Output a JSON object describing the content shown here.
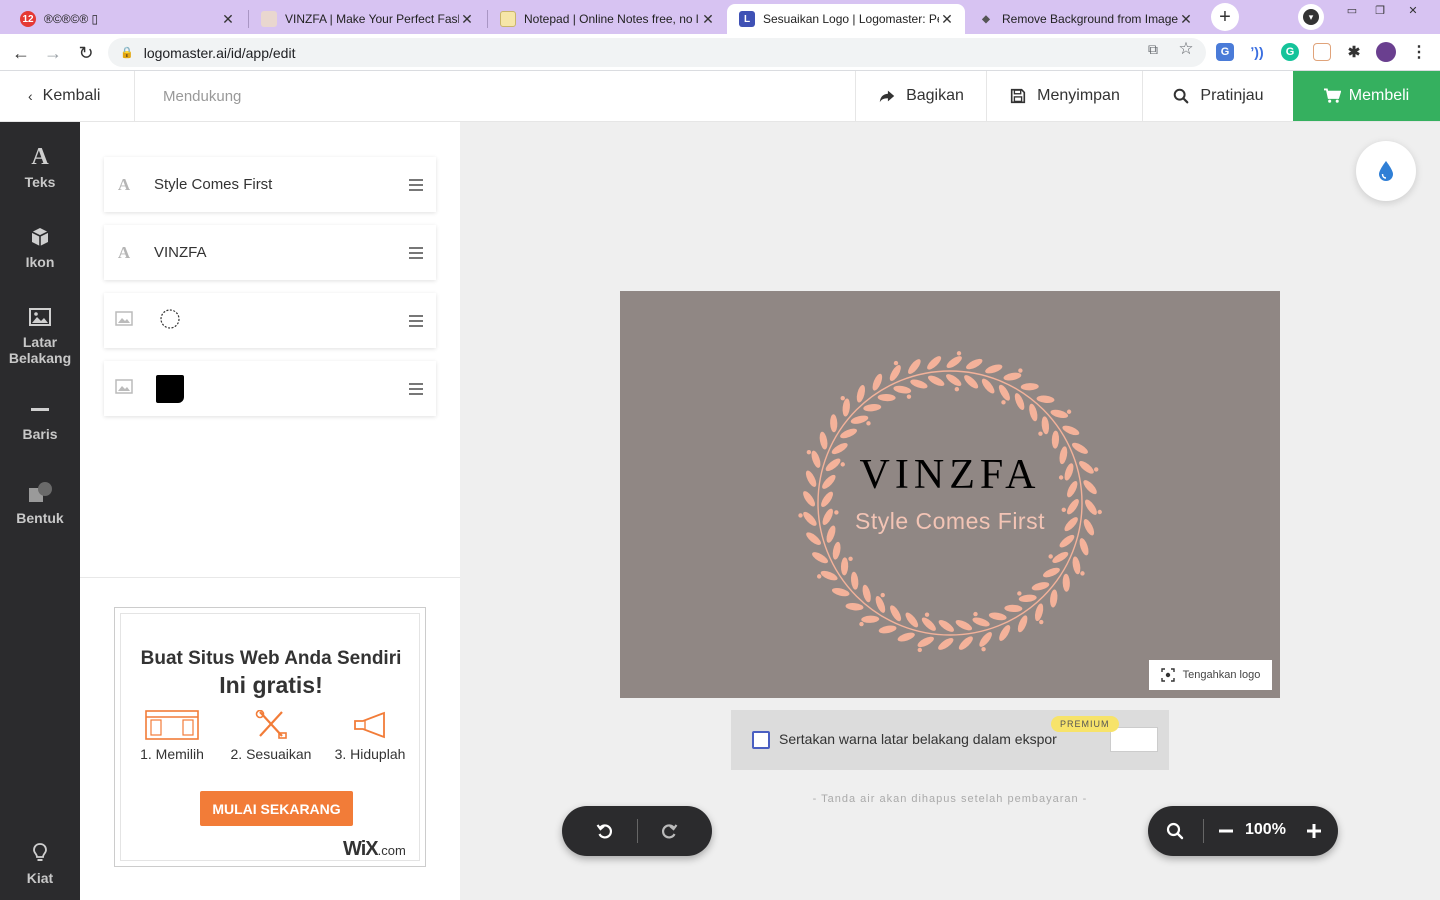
{
  "browser": {
    "tabs": [
      {
        "title": "®©®©® ▯",
        "favicon_label": "12",
        "favicon_color": "#e53935"
      },
      {
        "title": "VINZFA | Make Your Perfect Fash",
        "favicon_label": "",
        "favicon_color": "#e9d7cf"
      },
      {
        "title": "Notepad | Online Notes free, no l",
        "favicon_label": "",
        "favicon_color": "#f6e6a8"
      },
      {
        "title": "Sesuaikan Logo | Logomaster: Pe",
        "favicon_label": "L",
        "favicon_color": "#3f51b5",
        "active": true
      },
      {
        "title": "Remove Background from Image",
        "favicon_label": "◆",
        "favicon_color": "#d8d0ee"
      }
    ],
    "close_glyph": "✕",
    "new_tab_glyph": "+",
    "url": "logomaster.ai/id/app/edit"
  },
  "topbar": {
    "back_label": "Kembali",
    "support_label": "Mendukung",
    "share_label": "Bagikan",
    "save_label": "Menyimpan",
    "preview_label": "Pratinjau",
    "buy_label": "Membeli"
  },
  "sidebar": {
    "items": [
      {
        "label": "Teks",
        "icon": "text-icon"
      },
      {
        "label": "Ikon",
        "icon": "box-icon"
      },
      {
        "label": "Latar Belakang",
        "icon": "image-icon"
      },
      {
        "label": "Baris",
        "icon": "line-icon"
      },
      {
        "label": "Bentuk",
        "icon": "shape-icon"
      }
    ],
    "tips_label": "Kiat"
  },
  "layers": [
    {
      "type": "text",
      "icon_glyph": "A",
      "label": "Style Comes First"
    },
    {
      "type": "text",
      "icon_glyph": "A",
      "label": "VINZFA"
    },
    {
      "type": "image",
      "preview": "circle-outline"
    },
    {
      "type": "image",
      "preview": "black-rounded-square"
    }
  ],
  "ad": {
    "title_line1": "Buat Situs Web Anda Sendiri",
    "title_line2": "Ini gratis!",
    "steps": [
      "1. Memilih",
      "2. Sesuaikan",
      "3. Hiduplah"
    ],
    "cta": "MULAI SEKARANG",
    "brand": "WiX",
    "brand_suffix": ".com"
  },
  "canvas": {
    "background_color": "#908784",
    "logo_name": "VINZFA",
    "slogan": "Style Comes First",
    "wreath_color": "#f4b29a",
    "center_logo_label": "Tengahkan logo",
    "export_label": "Sertakan warna latar belakang dalam ekspor",
    "premium_badge": "PREMIUM",
    "watermark_note": "- Tanda air akan dihapus setelah pembayaran -",
    "zoom": "100%"
  },
  "colors": {
    "accent_green": "#35b05f",
    "rail": "#2b2b2d"
  }
}
